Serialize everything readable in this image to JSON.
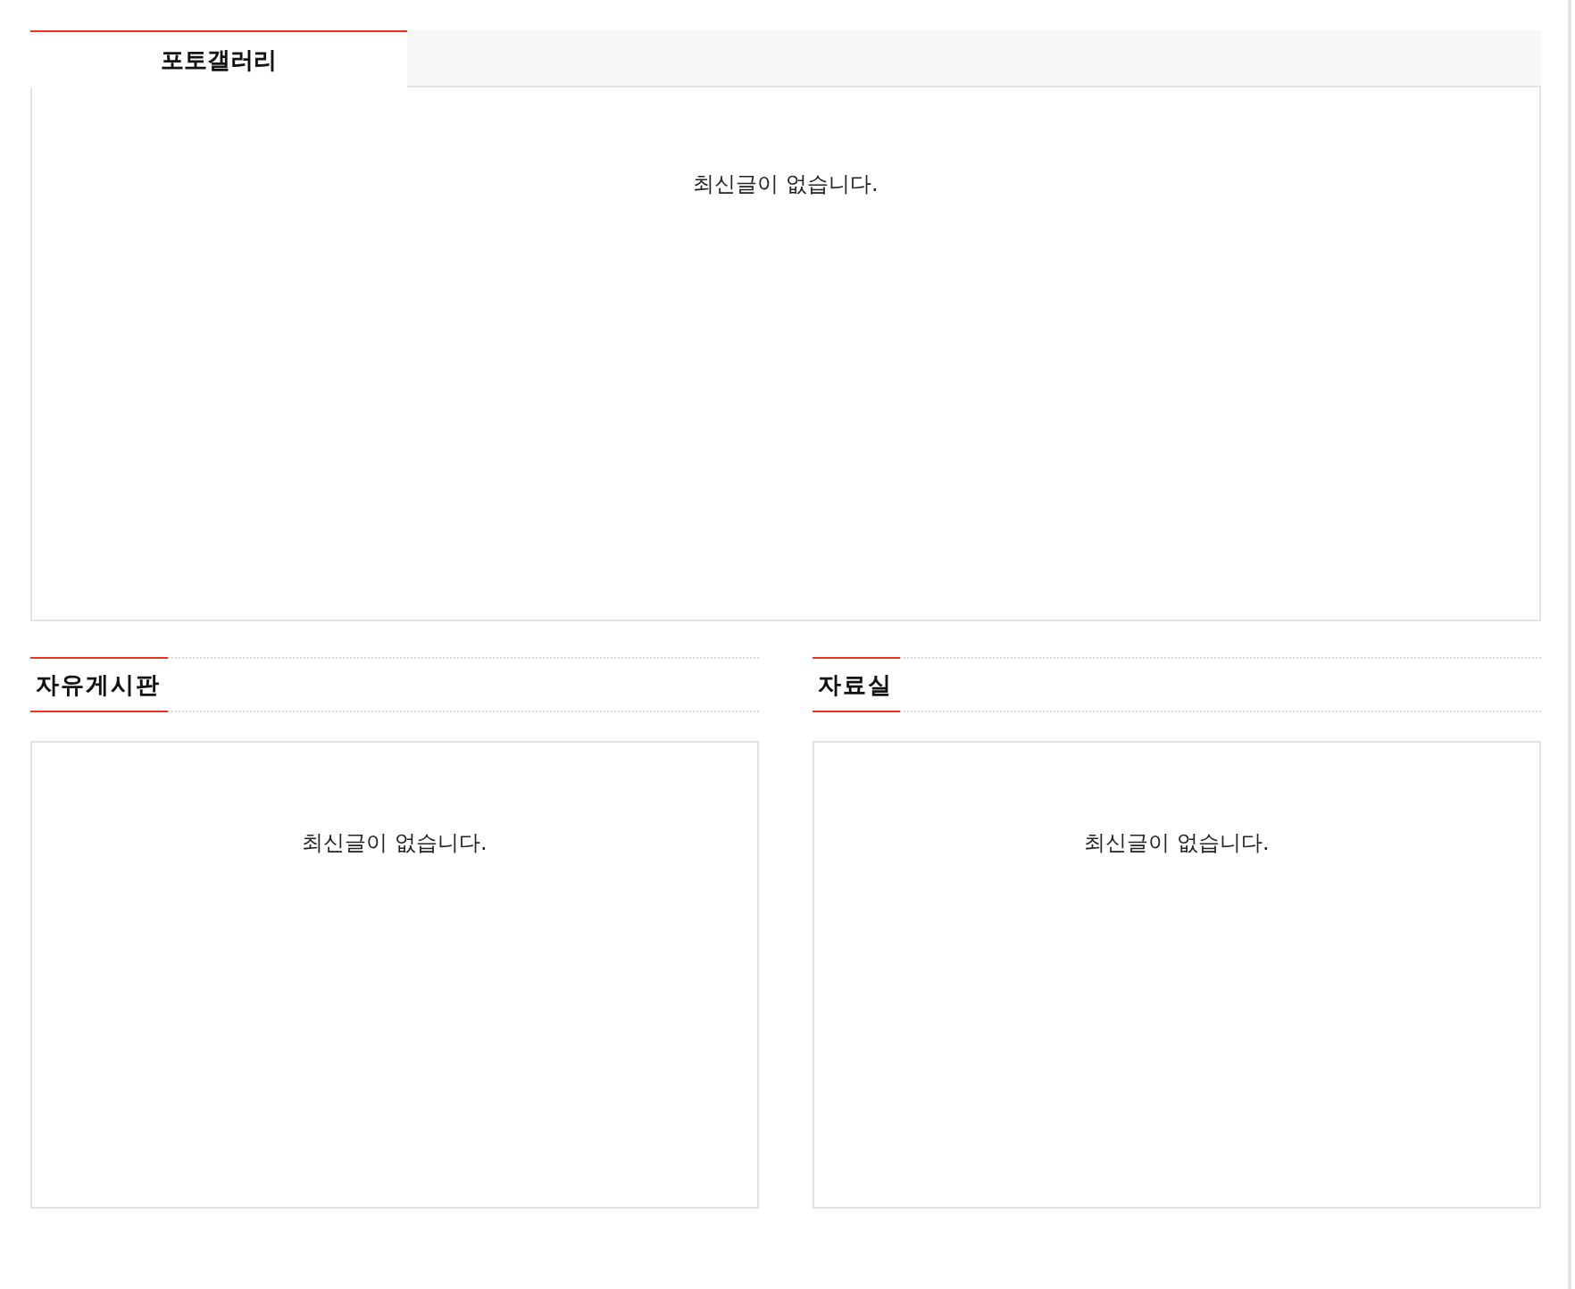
{
  "gallery": {
    "tabs": [
      {
        "label": "포토갤러리",
        "selected": true
      }
    ],
    "empty_message": "최신글이 없습니다."
  },
  "boards": [
    {
      "title": "자유게시판",
      "empty_message": "최신글이 없습니다."
    },
    {
      "title": "자료실",
      "empty_message": "최신글이 없습니다."
    }
  ]
}
